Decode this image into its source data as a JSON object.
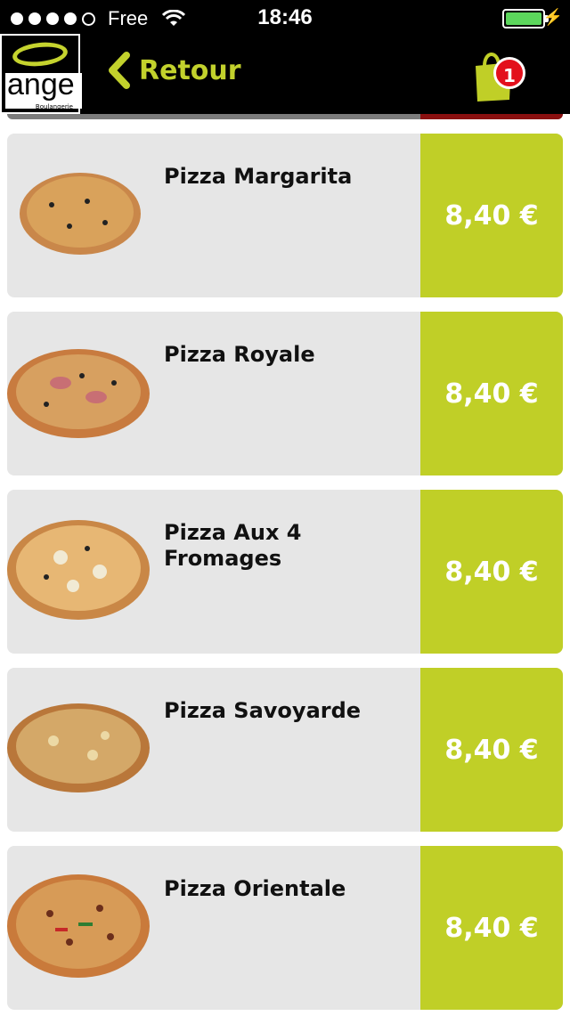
{
  "status_bar": {
    "carrier": "Free",
    "time": "18:46",
    "signal_icon": "signal-dots",
    "wifi_icon": "wifi",
    "battery_icon": "battery-charging",
    "charging_icon": "bolt"
  },
  "header": {
    "logo_text": "ange",
    "logo_subtitle": "Boulangerie",
    "back_label": "Retour",
    "back_icon": "chevron-left",
    "cart_icon": "shopping-bag",
    "cart_count": "1"
  },
  "colors": {
    "accent": "#c0cf27",
    "badge": "#e3101c",
    "card_bg": "#e6e6e6"
  },
  "products": [
    {
      "name": "Pizza Margarita",
      "price": "8,40 €"
    },
    {
      "name": "Pizza Royale",
      "price": "8,40 €"
    },
    {
      "name": "Pizza Aux 4 Fromages",
      "price": "8,40 €"
    },
    {
      "name": "Pizza Savoyarde",
      "price": "8,40 €"
    },
    {
      "name": "Pizza Orientale",
      "price": "8,40 €"
    }
  ]
}
